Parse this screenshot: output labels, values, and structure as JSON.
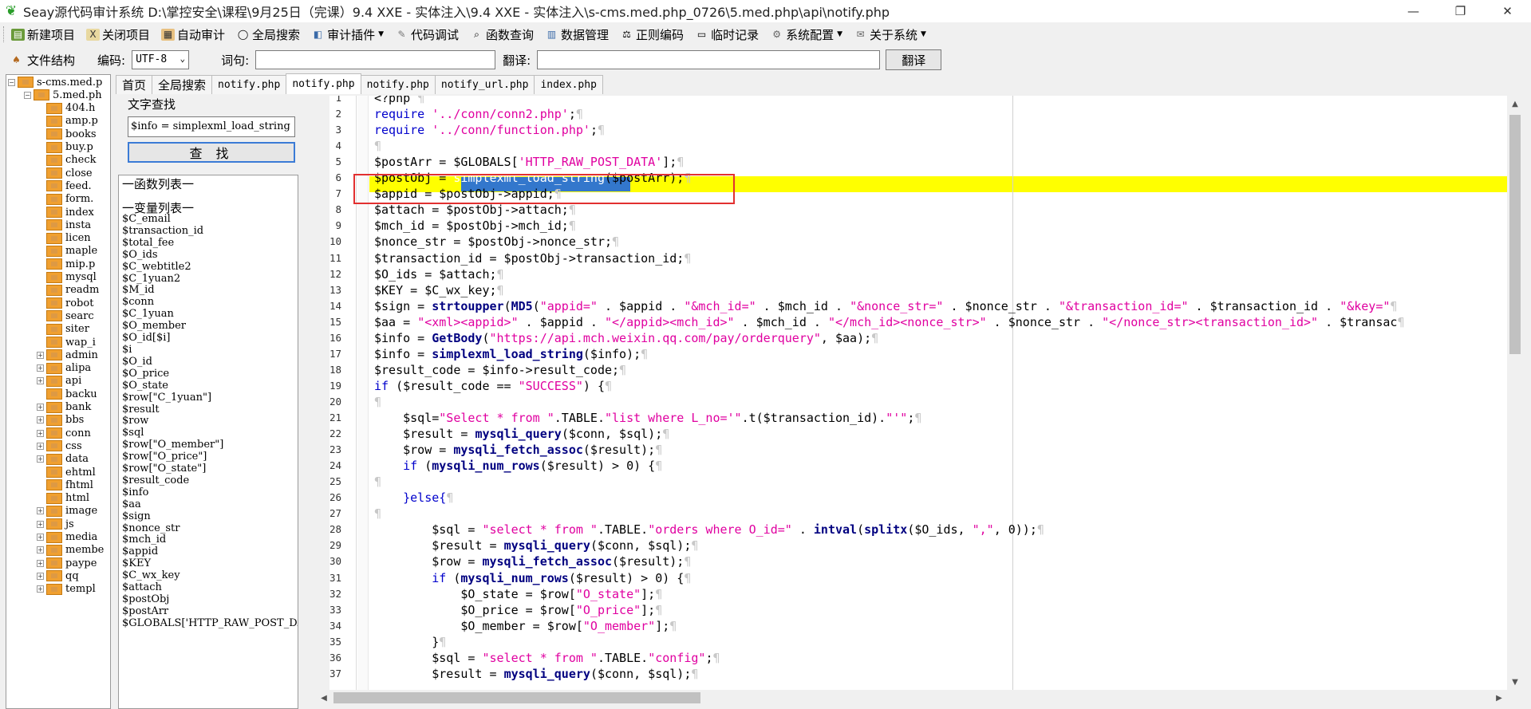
{
  "window": {
    "title": "Seay源代码审计系统  D:\\掌控安全\\课程\\9月25日（完课）9.4 XXE - 实体注入\\9.4 XXE - 实体注入\\s-cms.med.php_0726\\5.med.php\\api\\notify.php",
    "minimize": "—",
    "maximize": "❐",
    "close": "✕"
  },
  "menu": {
    "items": [
      "新建项目",
      "关闭项目",
      "自动审计",
      "全局搜索",
      "审计插件",
      "代码调试",
      "函数查询",
      "数据管理",
      "正则编码",
      "临时记录",
      "系统配置",
      "关于系统"
    ]
  },
  "toolbar": {
    "file_structure": "文件结构",
    "encoding_label": "编码:",
    "encoding_value": "UTF-8",
    "word_label": "词句:",
    "word_value": "",
    "translate_label": "翻译:",
    "translate_value": "",
    "translate_button": "翻译"
  },
  "tree": [
    {
      "label": "s-cms.med.p",
      "expander": "⊟",
      "level": 0
    },
    {
      "label": "5.med.ph",
      "expander": "⊟",
      "level": 1
    },
    {
      "label": "404.h",
      "level": 2
    },
    {
      "label": "amp.p",
      "level": 2
    },
    {
      "label": "books",
      "level": 2
    },
    {
      "label": "buy.p",
      "level": 2
    },
    {
      "label": "check",
      "level": 2
    },
    {
      "label": "close",
      "level": 2
    },
    {
      "label": "feed.",
      "level": 2
    },
    {
      "label": "form.",
      "level": 2
    },
    {
      "label": "index",
      "level": 2
    },
    {
      "label": "insta",
      "level": 2
    },
    {
      "label": "licen",
      "level": 2
    },
    {
      "label": "maple",
      "level": 2
    },
    {
      "label": "mip.p",
      "level": 2
    },
    {
      "label": "mysql",
      "level": 2
    },
    {
      "label": "readm",
      "level": 2
    },
    {
      "label": "robot",
      "level": 2
    },
    {
      "label": "searc",
      "level": 2
    },
    {
      "label": "siter",
      "level": 2
    },
    {
      "label": "wap_i",
      "level": 2
    },
    {
      "label": "admin",
      "expander": "⊞",
      "level": 2
    },
    {
      "label": "alipa",
      "expander": "⊞",
      "level": 2
    },
    {
      "label": "api",
      "expander": "⊞",
      "level": 2
    },
    {
      "label": "backu",
      "level": 2
    },
    {
      "label": "bank",
      "expander": "⊞",
      "level": 2
    },
    {
      "label": "bbs",
      "expander": "⊞",
      "level": 2
    },
    {
      "label": "conn",
      "expander": "⊞",
      "level": 2
    },
    {
      "label": "css",
      "expander": "⊞",
      "level": 2
    },
    {
      "label": "data",
      "expander": "⊞",
      "level": 2
    },
    {
      "label": "ehtml",
      "level": 2
    },
    {
      "label": "fhtml",
      "level": 2
    },
    {
      "label": "html",
      "level": 2
    },
    {
      "label": "image",
      "expander": "⊞",
      "level": 2
    },
    {
      "label": "js",
      "expander": "⊞",
      "level": 2
    },
    {
      "label": "media",
      "expander": "⊞",
      "level": 2
    },
    {
      "label": "membe",
      "expander": "⊞",
      "level": 2
    },
    {
      "label": "paype",
      "expander": "⊞",
      "level": 2
    },
    {
      "label": "qq",
      "expander": "⊞",
      "level": 2
    },
    {
      "label": "templ",
      "expander": "⊞",
      "level": 2
    }
  ],
  "tabs": [
    {
      "label": "首页",
      "mono": false
    },
    {
      "label": "全局搜索",
      "mono": false
    },
    {
      "label": "notify.php",
      "mono": true
    },
    {
      "label": "notify.php",
      "mono": true,
      "active": true
    },
    {
      "label": "notify.php",
      "mono": true
    },
    {
      "label": "notify_url.php",
      "mono": true
    },
    {
      "label": "index.php",
      "mono": true
    }
  ],
  "find": {
    "group": "文字查找",
    "value": "$info = simplexml_load_string",
    "button": "查 找"
  },
  "lists": {
    "functions_head": "一函数列表一",
    "variables_head": "一变量列表一",
    "variables": [
      "$C_email",
      "$transaction_id",
      "$total_fee",
      "$O_ids",
      "$C_webtitle2",
      "$C_1yuan2",
      "$M_id",
      "$conn",
      "$C_1yuan",
      "$O_member",
      "$O_id[$i]",
      "$i",
      "$O_id",
      "$O_price",
      "$O_state",
      "$row[\"C_1yuan\"]",
      "$result",
      "$row",
      "$sql",
      "$row[\"O_member\"]",
      "$row[\"O_price\"]",
      "$row[\"O_state\"]",
      "$result_code",
      "$info",
      "$aa",
      "$sign",
      "$nonce_str",
      "$mch_id",
      "$appid",
      "$KEY",
      "$C_wx_key",
      "$attach",
      "$postObj",
      "$postArr",
      "$GLOBALS['HTTP_RAW_POST_DATA'"
    ]
  },
  "editor": {
    "highlight_line": 6,
    "lines": [
      [
        [
          "<?php ",
          "vr"
        ]
      ],
      [
        [
          "require ",
          "kw"
        ],
        [
          "'../conn/conn2.php'",
          "st"
        ],
        [
          ";",
          "vr"
        ]
      ],
      [
        [
          "require ",
          "kw"
        ],
        [
          "'../conn/function.php'",
          "st"
        ],
        [
          ";",
          "vr"
        ]
      ],
      [],
      [
        [
          "$postArr = $GLOBALS[",
          "vr"
        ],
        [
          "'HTTP_RAW_POST_DATA'",
          "st"
        ],
        [
          "];",
          "vr"
        ]
      ],
      [
        [
          "$postObj = ",
          "vr"
        ],
        [
          "simplexml_load_string",
          "sel-text"
        ],
        [
          "($postArr);",
          "vr"
        ]
      ],
      [
        [
          "$appid = $postObj->appid;",
          "vr"
        ]
      ],
      [
        [
          "$attach = $postObj->attach;",
          "vr"
        ]
      ],
      [
        [
          "$mch_id = $postObj->mch_id;",
          "vr"
        ]
      ],
      [
        [
          "$nonce_str = $postObj->nonce_str;",
          "vr"
        ]
      ],
      [
        [
          "$transaction_id = $postObj->transaction_id;",
          "vr"
        ]
      ],
      [
        [
          "$O_ids = $attach;",
          "vr"
        ]
      ],
      [
        [
          "$KEY = $C_wx_key;",
          "vr"
        ]
      ],
      [
        [
          "$sign = ",
          "vr"
        ],
        [
          "strtoupper",
          "fn"
        ],
        [
          "(",
          "vr"
        ],
        [
          "MD5",
          "fn"
        ],
        [
          "(",
          "vr"
        ],
        [
          "\"appid=\"",
          "st"
        ],
        [
          " . $appid . ",
          "vr"
        ],
        [
          "\"&mch_id=\"",
          "st"
        ],
        [
          " . $mch_id . ",
          "vr"
        ],
        [
          "\"&nonce_str=\"",
          "st"
        ],
        [
          " . $nonce_str . ",
          "vr"
        ],
        [
          "\"&transaction_id=\"",
          "st"
        ],
        [
          " . $transaction_id . ",
          "vr"
        ],
        [
          "\"&key=\"",
          "st"
        ]
      ],
      [
        [
          "$aa = ",
          "vr"
        ],
        [
          "\"<xml><appid>\"",
          "st"
        ],
        [
          " . $appid . ",
          "vr"
        ],
        [
          "\"</appid><mch_id>\"",
          "st"
        ],
        [
          " . $mch_id . ",
          "vr"
        ],
        [
          "\"</mch_id><nonce_str>\"",
          "st"
        ],
        [
          " . $nonce_str . ",
          "vr"
        ],
        [
          "\"</nonce_str><transaction_id>\"",
          "st"
        ],
        [
          " . $transac",
          "vr"
        ]
      ],
      [
        [
          "$info = ",
          "vr"
        ],
        [
          "GetBody",
          "fn"
        ],
        [
          "(",
          "vr"
        ],
        [
          "\"https://api.mch.weixin.qq.com/pay/orderquery\"",
          "st"
        ],
        [
          ", $aa);",
          "vr"
        ]
      ],
      [
        [
          "$info = ",
          "vr"
        ],
        [
          "simplexml_load_string",
          "fn"
        ],
        [
          "($info);",
          "vr"
        ]
      ],
      [
        [
          "$result_code = $info->result_code;",
          "vr"
        ]
      ],
      [
        [
          "if ",
          "kw"
        ],
        [
          "($result_code == ",
          "vr"
        ],
        [
          "\"SUCCESS\"",
          "st"
        ],
        [
          ") {",
          "vr"
        ]
      ],
      [],
      [
        [
          "    $sql=",
          "vr"
        ],
        [
          "\"Select * from \"",
          "st"
        ],
        [
          ".TABLE.",
          "vr"
        ],
        [
          "\"list where L_no='\"",
          "st"
        ],
        [
          ".t($transaction_id).",
          "vr"
        ],
        [
          "\"'\"",
          "st"
        ],
        [
          ";",
          "vr"
        ]
      ],
      [
        [
          "    $result = ",
          "vr"
        ],
        [
          "mysqli_query",
          "fn"
        ],
        [
          "($conn, $sql);",
          "vr"
        ]
      ],
      [
        [
          "    $row = ",
          "vr"
        ],
        [
          "mysqli_fetch_assoc",
          "fn"
        ],
        [
          "($result);",
          "vr"
        ]
      ],
      [
        [
          "    if ",
          "kw"
        ],
        [
          "(",
          "vr"
        ],
        [
          "mysqli_num_rows",
          "fn"
        ],
        [
          "($result) > 0) {",
          "vr"
        ]
      ],
      [],
      [
        [
          "    }else{",
          "kw"
        ]
      ],
      [],
      [
        [
          "        $sql = ",
          "vr"
        ],
        [
          "\"select * from \"",
          "st"
        ],
        [
          ".TABLE.",
          "vr"
        ],
        [
          "\"orders where O_id=\"",
          "st"
        ],
        [
          " . ",
          "vr"
        ],
        [
          "intval",
          "fn"
        ],
        [
          "(",
          "vr"
        ],
        [
          "splitx",
          "fn"
        ],
        [
          "($O_ids, ",
          "vr"
        ],
        [
          "\",\"",
          "st"
        ],
        [
          ", 0));",
          "vr"
        ]
      ],
      [
        [
          "        $result = ",
          "vr"
        ],
        [
          "mysqli_query",
          "fn"
        ],
        [
          "($conn, $sql);",
          "vr"
        ]
      ],
      [
        [
          "        $row = ",
          "vr"
        ],
        [
          "mysqli_fetch_assoc",
          "fn"
        ],
        [
          "($result);",
          "vr"
        ]
      ],
      [
        [
          "        if ",
          "kw"
        ],
        [
          "(",
          "vr"
        ],
        [
          "mysqli_num_rows",
          "fn"
        ],
        [
          "($result) > 0) {",
          "vr"
        ]
      ],
      [
        [
          "            $O_state = $row[",
          "vr"
        ],
        [
          "\"O_state\"",
          "st"
        ],
        [
          "];",
          "vr"
        ]
      ],
      [
        [
          "            $O_price = $row[",
          "vr"
        ],
        [
          "\"O_price\"",
          "st"
        ],
        [
          "];",
          "vr"
        ]
      ],
      [
        [
          "            $O_member = $row[",
          "vr"
        ],
        [
          "\"O_member\"",
          "st"
        ],
        [
          "];",
          "vr"
        ]
      ],
      [
        [
          "        }",
          "vr"
        ]
      ],
      [
        [
          "        $sql = ",
          "vr"
        ],
        [
          "\"select * from \"",
          "st"
        ],
        [
          ".TABLE.",
          "vr"
        ],
        [
          "\"config\"",
          "st"
        ],
        [
          ";",
          "vr"
        ]
      ],
      [
        [
          "        $result = ",
          "vr"
        ],
        [
          "mysqli_query",
          "fn"
        ],
        [
          "($conn, $sql);",
          "vr"
        ]
      ]
    ]
  }
}
